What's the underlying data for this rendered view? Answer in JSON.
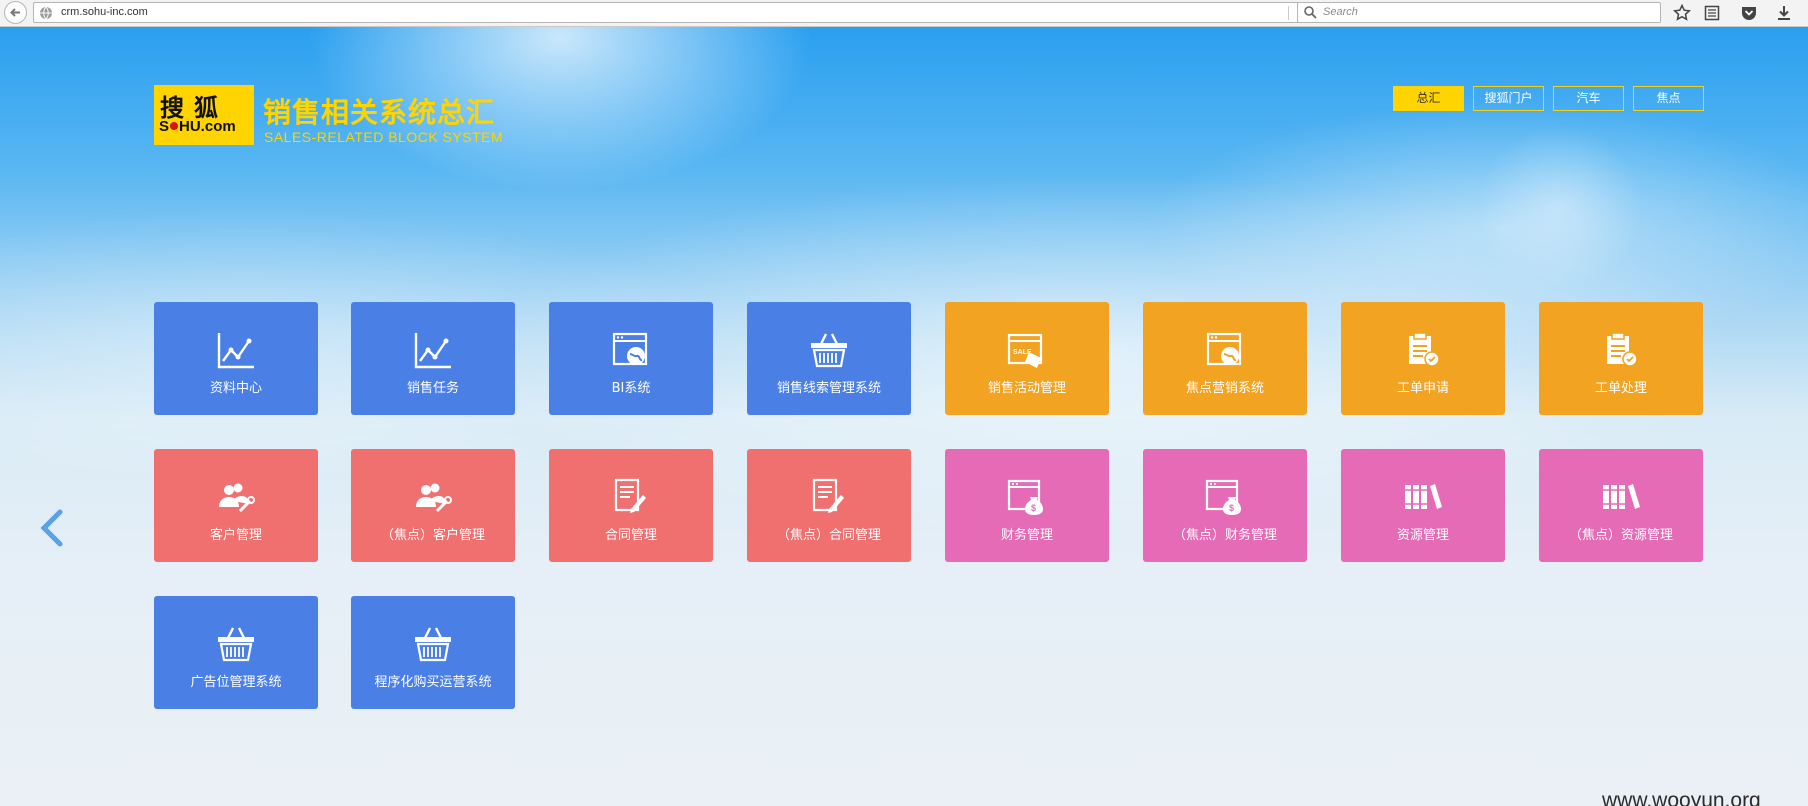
{
  "browser": {
    "url": "crm.sohu-inc.com",
    "search_placeholder": "Search"
  },
  "header": {
    "logo_cn": "搜狐",
    "logo_en_left": "S",
    "logo_en_right": "HU.com",
    "title": "销售相关系统总汇",
    "subtitle": "SALES-RELATED BLOCK SYSTEM"
  },
  "topnav": [
    {
      "label": "总汇",
      "active": true
    },
    {
      "label": "搜狐门户",
      "active": false
    },
    {
      "label": "汽车",
      "active": false
    },
    {
      "label": "焦点",
      "active": false
    }
  ],
  "colors": {
    "blue": "#4a7fe6",
    "orange": "#f1a321",
    "red": "#f07070",
    "pink": "#e66bb6",
    "yellow": "#ffd400"
  },
  "tiles": [
    {
      "label": "资料中心",
      "icon": "line-chart-icon",
      "color": "blue"
    },
    {
      "label": "销售任务",
      "icon": "line-chart-icon",
      "color": "blue"
    },
    {
      "label": "BI系统",
      "icon": "web-globe-icon",
      "color": "blue"
    },
    {
      "label": "销售线索管理系统",
      "icon": "basket-icon",
      "color": "blue"
    },
    {
      "label": "销售活动管理",
      "icon": "sale-tag-icon",
      "color": "orange"
    },
    {
      "label": "焦点营销系统",
      "icon": "web-globe-icon",
      "color": "orange"
    },
    {
      "label": "工单申请",
      "icon": "clipboard-icon",
      "color": "orange"
    },
    {
      "label": "工单处理",
      "icon": "clipboard-icon",
      "color": "orange"
    },
    {
      "label": "客户管理",
      "icon": "users-wrench-icon",
      "color": "red"
    },
    {
      "label": "（焦点）客户管理",
      "icon": "users-wrench-icon",
      "color": "red"
    },
    {
      "label": "合同管理",
      "icon": "contract-edit-icon",
      "color": "red"
    },
    {
      "label": "（焦点）合同管理",
      "icon": "contract-edit-icon",
      "color": "red"
    },
    {
      "label": "财务管理",
      "icon": "money-bag-icon",
      "color": "pink"
    },
    {
      "label": "（焦点）财务管理",
      "icon": "money-bag-icon",
      "color": "pink"
    },
    {
      "label": "资源管理",
      "icon": "books-icon",
      "color": "pink"
    },
    {
      "label": "（焦点）资源管理",
      "icon": "books-icon",
      "color": "pink"
    },
    {
      "label": "广告位管理系统",
      "icon": "basket-icon",
      "color": "blue"
    },
    {
      "label": "程序化购买运营系统",
      "icon": "basket-icon",
      "color": "blue"
    }
  ],
  "watermark": "www.wooyun.org"
}
